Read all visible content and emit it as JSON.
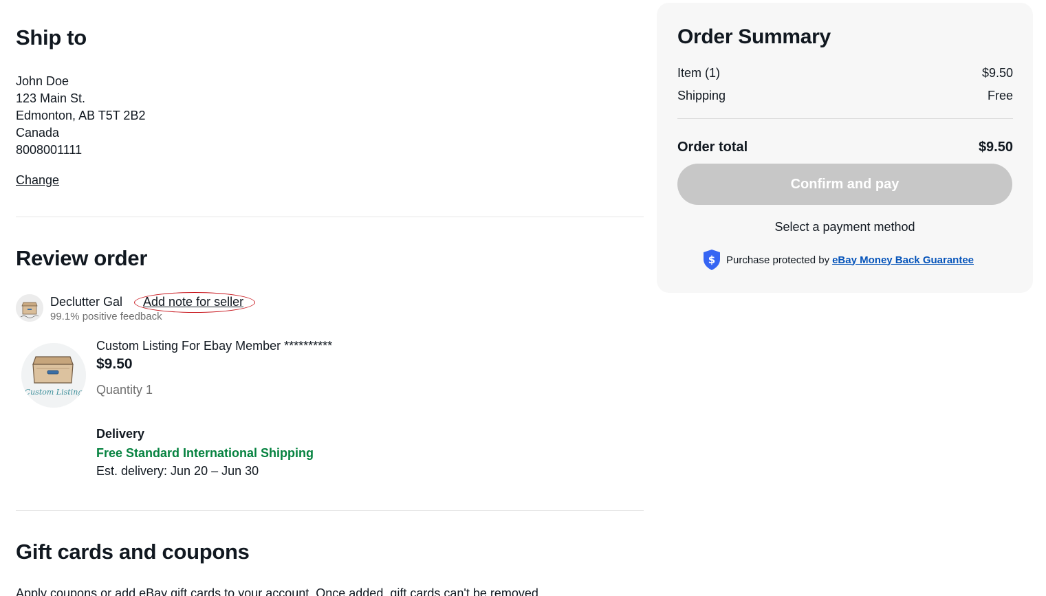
{
  "ship_to": {
    "title": "Ship to",
    "name": "John Doe",
    "street": "123 Main St.",
    "city_line": "Edmonton, AB T5T 2B2",
    "country": "Canada",
    "phone": "8008001111",
    "change_label": "Change"
  },
  "review": {
    "title": "Review order",
    "seller": {
      "name": "Declutter Gal",
      "note_label": "Add note for seller",
      "feedback": "99.1% positive feedback",
      "avatar_icon": "seller-box-avatar-icon"
    },
    "item": {
      "title": "Custom Listing For Ebay Member **********",
      "price": "$9.50",
      "quantity": "Quantity 1",
      "image_icon": "custom-listing-box-icon",
      "image_caption": "Custom Listing"
    },
    "delivery": {
      "label": "Delivery",
      "method": "Free Standard International Shipping",
      "estimate": "Est. delivery: Jun 20 – Jun 30"
    }
  },
  "gift": {
    "title": "Gift cards and coupons",
    "description": "Apply coupons or add eBay gift cards to your account. Once added, gift cards can't be removed."
  },
  "summary": {
    "title": "Order Summary",
    "item_label": "Item (1)",
    "item_value": "$9.50",
    "shipping_label": "Shipping",
    "shipping_value": "Free",
    "total_label": "Order total",
    "total_value": "$9.50",
    "confirm_label": "Confirm and pay",
    "payment_hint": "Select a payment method",
    "protection_text": "Purchase protected by",
    "protection_link": "eBay Money Back Guarantee",
    "shield_icon": "dollar-shield-icon"
  },
  "colors": {
    "accent_link": "#0654ba",
    "shipping_green": "#05823f",
    "disabled_button": "#c7c7c7",
    "panel_bg": "#f7f7f7",
    "annotation_red": "#c8181f"
  }
}
